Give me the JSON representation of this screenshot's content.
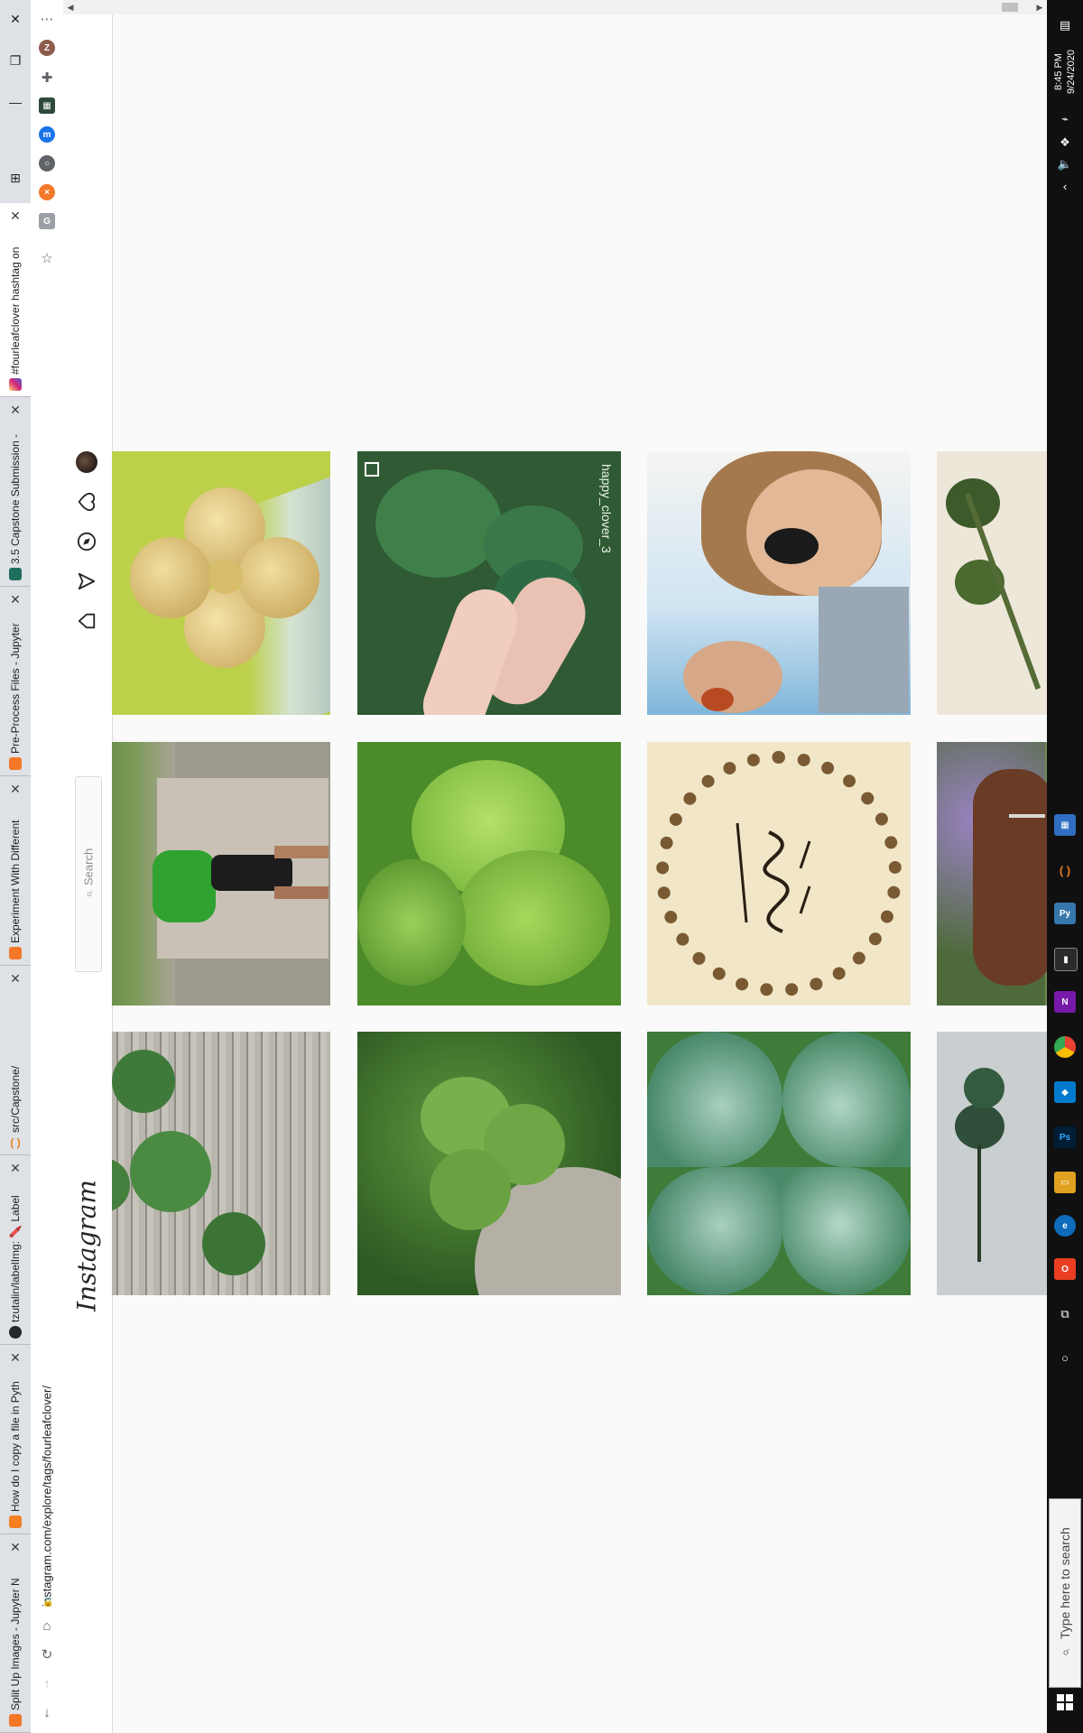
{
  "browser": {
    "tabs": [
      {
        "title": "Split Up Images - Jupyter N",
        "favicon": "jupyter-icon",
        "favicon_color": "#f37726",
        "active": false
      },
      {
        "title": "How do I copy a file in Pyth",
        "favicon": "stackoverflow-icon",
        "favicon_color": "#f48024",
        "active": false
      },
      {
        "title": "tzutalin/labelImg: 🖍️ Label",
        "favicon": "github-icon",
        "favicon_color": "#24292e",
        "active": false
      },
      {
        "title": "src/Capstone/",
        "favicon": "brackets-icon",
        "favicon_color": "#e67e22",
        "active": false
      },
      {
        "title": "Experiment With Different",
        "favicon": "jupyter-icon",
        "favicon_color": "#f37726",
        "active": false
      },
      {
        "title": "Pre-Process Files - Jupyter N",
        "favicon": "jupyter-icon",
        "favicon_color": "#f37726",
        "active": false
      },
      {
        "title": "3.5 Capstone Submission -",
        "favicon": "springboard-icon",
        "favicon_color": "#1f6f5c",
        "active": false
      },
      {
        "title": "#fourleafclover hashtag on",
        "favicon": "instagram-icon",
        "favicon_color": "#c13584",
        "active": true
      }
    ],
    "url": "instagram.com/explore/tags/fourleafclover/",
    "profile_initial": "Z"
  },
  "instagram": {
    "logo": "Instagram",
    "search_placeholder": "Search",
    "overlay_text_post2": "happy_clover_3"
  },
  "taskbar": {
    "search_placeholder": "Type here to search",
    "time": "8:45 PM",
    "date": "9/24/2020"
  },
  "colors": {
    "accent": "#1a73e8",
    "taskbar": "#101010"
  }
}
